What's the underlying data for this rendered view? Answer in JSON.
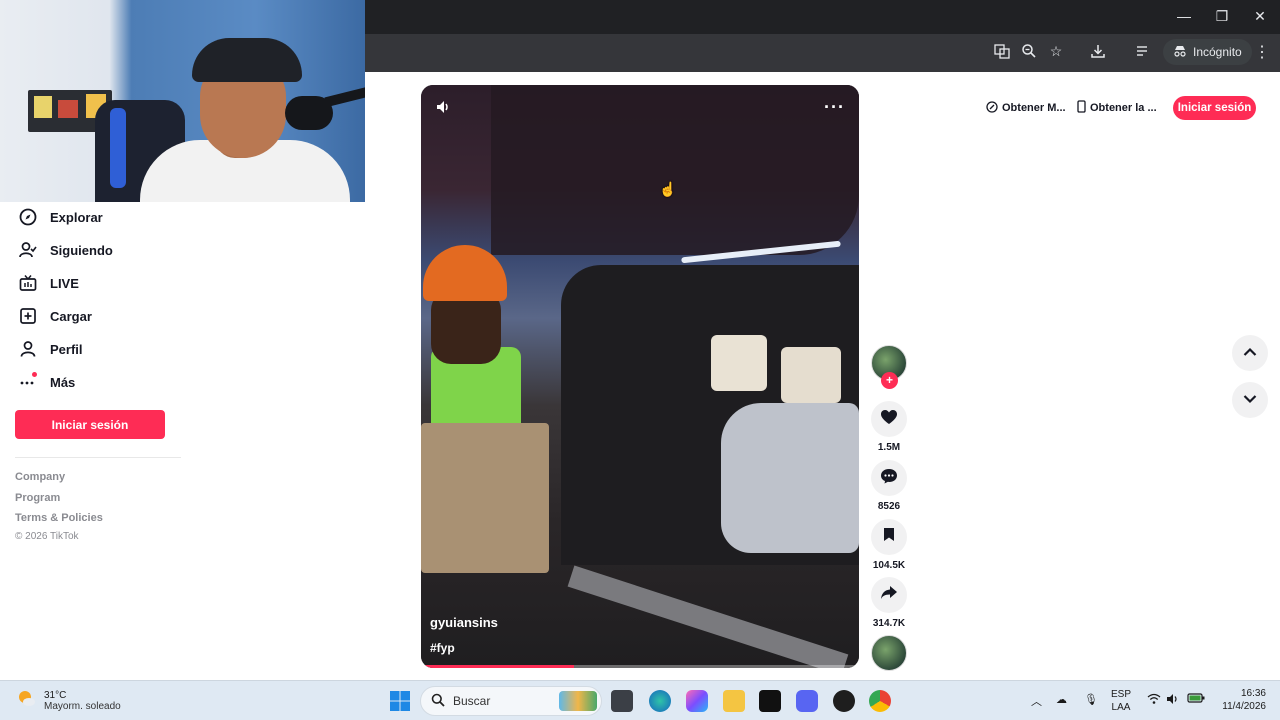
{
  "browser": {
    "incognito_label": "Incógnito"
  },
  "sidebar": {
    "items": [
      {
        "label": "Explorar"
      },
      {
        "label": "Siguiendo"
      },
      {
        "label": "LIVE"
      },
      {
        "label": "Cargar"
      },
      {
        "label": "Perfil"
      },
      {
        "label": "Más"
      }
    ],
    "login_button": "Iniciar sesión",
    "footer_links": [
      "Company",
      "Program",
      "Terms & Policies"
    ],
    "copyright": "© 2026 TikTok"
  },
  "video": {
    "username": "gyuiansins",
    "hashtag": "#fyp",
    "progress_fraction": 0.35
  },
  "actions": {
    "likes": "1.5M",
    "comments": "8526",
    "saves": "104.5K",
    "shares": "314.7K"
  },
  "top_bar": {
    "get_more": "Obtener M...",
    "get_app": "Obtener la ...",
    "login": "Iniciar sesión"
  },
  "taskbar": {
    "temperature": "31°C",
    "weather": "Mayorm. soleado",
    "search_placeholder": "Buscar",
    "lang_top": "ESP",
    "lang_bottom": "LAA",
    "time": "16:36",
    "date": "11/4/2026"
  },
  "colors": {
    "accent": "#fe2c55",
    "chrome_dark": "#202124",
    "taskbar": "#dfe9f3"
  }
}
